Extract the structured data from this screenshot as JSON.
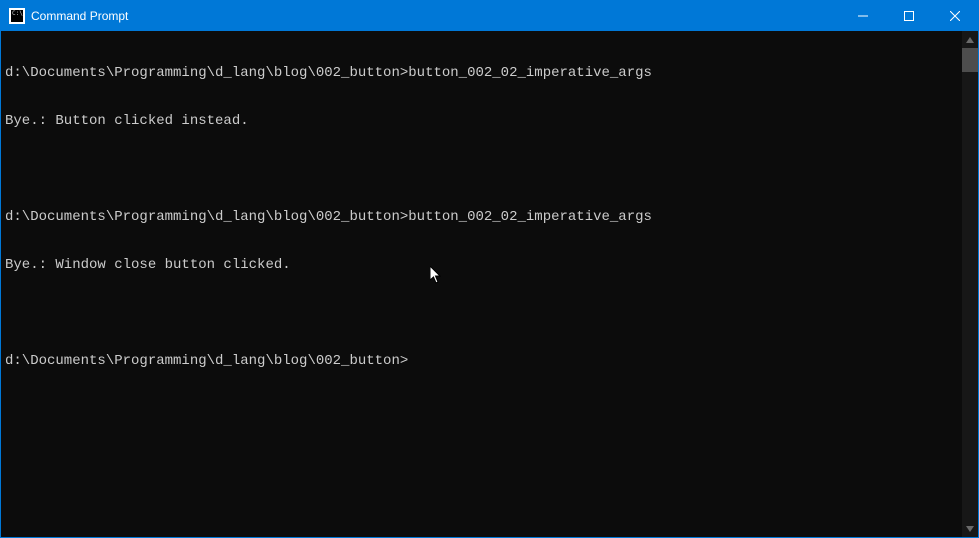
{
  "window": {
    "title": "Command Prompt"
  },
  "terminal": {
    "lines": [
      "d:\\Documents\\Programming\\d_lang\\blog\\002_button>button_002_02_imperative_args",
      "Bye.: Button clicked instead.",
      "",
      "d:\\Documents\\Programming\\d_lang\\blog\\002_button>button_002_02_imperative_args",
      "Bye.: Window close button clicked.",
      "",
      "d:\\Documents\\Programming\\d_lang\\blog\\002_button>"
    ]
  }
}
